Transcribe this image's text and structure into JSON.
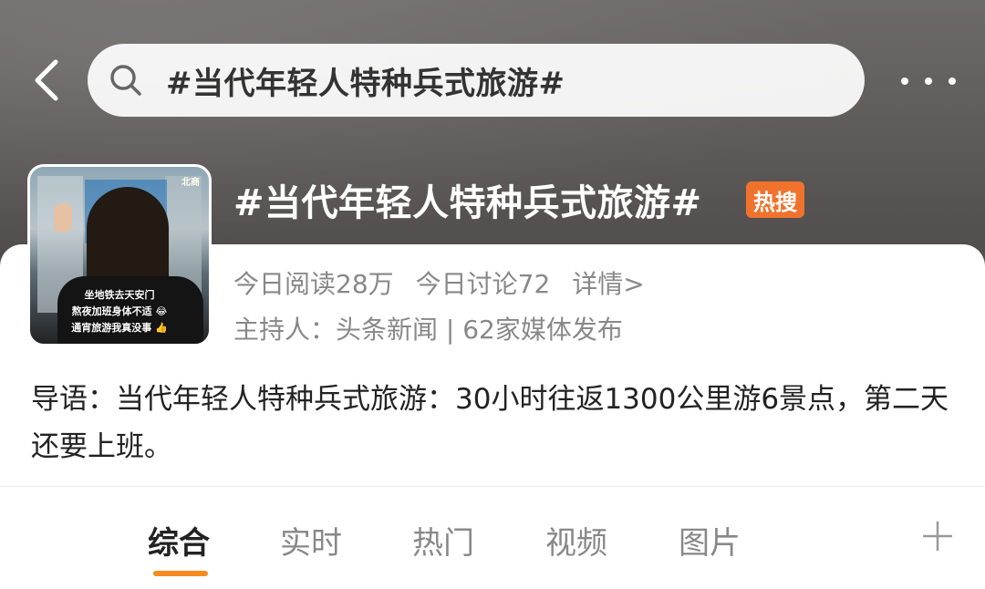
{
  "search": {
    "query": "#当代年轻人特种兵式旅游#"
  },
  "topic": {
    "title": "#当代年轻人特种兵式旅游#",
    "badge": "热搜",
    "reads": "今日阅读28万",
    "discussions": "今日讨论72",
    "detail_link": "详情>",
    "host_line": "主持人：头条新闻 | 62家媒体发布",
    "intro": "导语：当代年轻人特种兵式旅游：30小时往返1300公里游6景点，第二天还要上班。",
    "cover": {
      "tag": "北商",
      "caption_1": "坐地铁去天安门",
      "caption_2": "熬夜加班身体不适 😂",
      "caption_3": "通宵旅游我真没事 👍"
    }
  },
  "tabs": [
    {
      "label": "综合",
      "active": true
    },
    {
      "label": "实时",
      "active": false
    },
    {
      "label": "热门",
      "active": false
    },
    {
      "label": "视频",
      "active": false
    },
    {
      "label": "图片",
      "active": false
    }
  ],
  "colors": {
    "accent": "#f78a1e",
    "badge": "#f0722c"
  },
  "icons": [
    "back-arrow-icon",
    "search-icon",
    "more-icon",
    "plus-icon"
  ]
}
